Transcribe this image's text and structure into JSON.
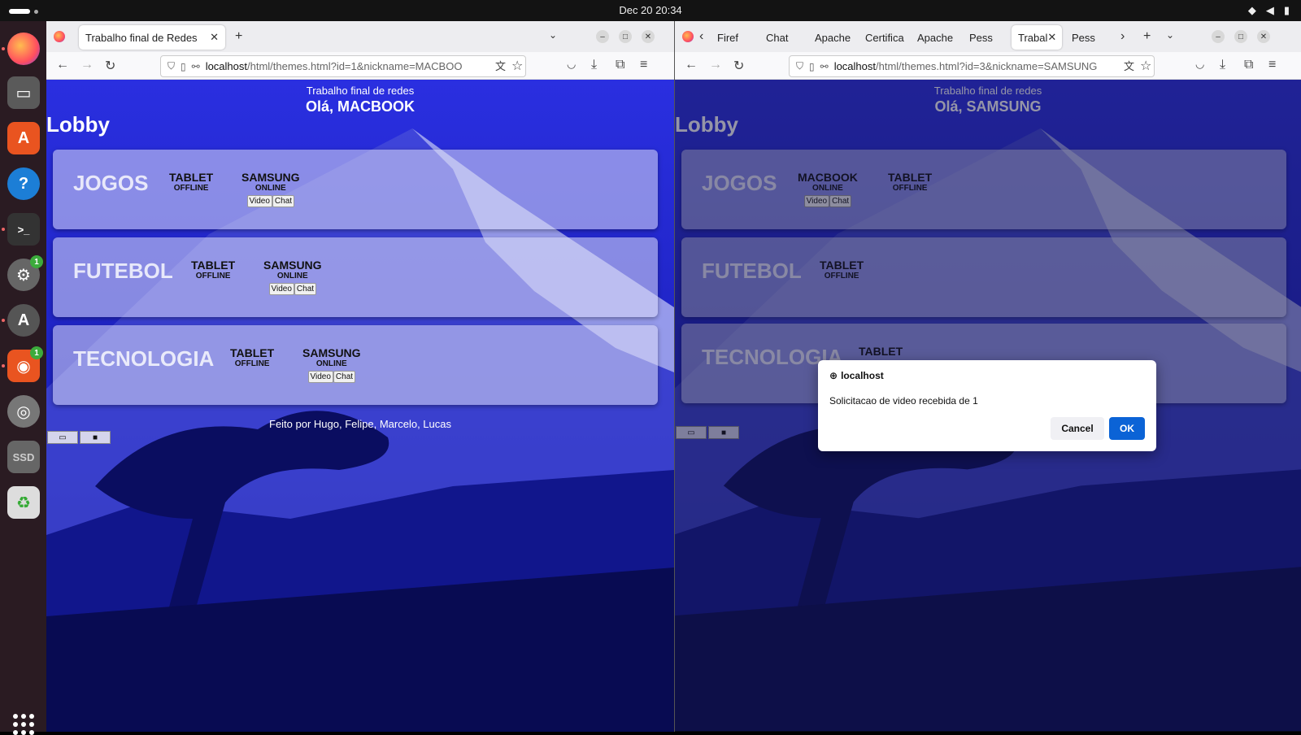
{
  "system": {
    "datetime": "Dec 20  20:34"
  },
  "dock": {
    "badges": [
      "1",
      "1"
    ],
    "ssd_label": "SSD"
  },
  "left_window": {
    "tabs": [
      {
        "label": "Trabalho final de Redes"
      }
    ],
    "url": {
      "host": "localhost",
      "path": "/html/themes.html?id=1&nickname=MACBOO"
    },
    "page": {
      "title": "Trabalho final de redes",
      "greeting": "Olá, MACBOOK",
      "lobby": "Lobby",
      "groups": [
        {
          "name": "JOGOS",
          "users": [
            {
              "name": "TABLET",
              "status": "OFFLINE",
              "actions": []
            },
            {
              "name": "SAMSUNG",
              "status": "ONLINE",
              "actions": [
                "Video",
                "Chat"
              ]
            }
          ]
        },
        {
          "name": "FUTEBOL",
          "users": [
            {
              "name": "TABLET",
              "status": "OFFLINE",
              "actions": []
            },
            {
              "name": "SAMSUNG",
              "status": "ONLINE",
              "actions": [
                "Video",
                "Chat"
              ]
            }
          ]
        },
        {
          "name": "TECNOLOGIA",
          "users": [
            {
              "name": "TABLET",
              "status": "OFFLINE",
              "actions": []
            },
            {
              "name": "SAMSUNG",
              "status": "ONLINE",
              "actions": [
                "Video",
                "Chat"
              ]
            }
          ]
        }
      ],
      "footer": "Feito por Hugo, Felipe, Marcelo, Lucas"
    }
  },
  "right_window": {
    "tabs": [
      {
        "label": "Firef"
      },
      {
        "label": "Chat"
      },
      {
        "label": "Apache"
      },
      {
        "label": "Certifica"
      },
      {
        "label": "Apache"
      },
      {
        "label": "Pess"
      },
      {
        "label": "Trabal"
      },
      {
        "label": "Pess"
      }
    ],
    "url": {
      "host": "localhost",
      "path": "/html/themes.html?id=3&nickname=SAMSUNG"
    },
    "page": {
      "title": "Trabalho final de redes",
      "greeting": "Olá, SAMSUNG",
      "lobby": "Lobby",
      "groups": [
        {
          "name": "JOGOS",
          "users": [
            {
              "name": "MACBOOK",
              "status": "ONLINE",
              "actions": [
                "Video",
                "Chat"
              ]
            },
            {
              "name": "TABLET",
              "status": "OFFLINE",
              "actions": []
            }
          ]
        },
        {
          "name": "FUTEBOL",
          "users": [
            {
              "name": "TABLET",
              "status": "OFFLINE",
              "actions": []
            }
          ]
        },
        {
          "name": "TECNOLOGIA",
          "users": [
            {
              "name": "TABLET",
              "status": "",
              "actions": []
            }
          ]
        }
      ]
    }
  },
  "dialog": {
    "origin": "localhost",
    "message": "Solicitacao de video recebida de 1",
    "cancel_label": "Cancel",
    "ok_label": "OK"
  }
}
